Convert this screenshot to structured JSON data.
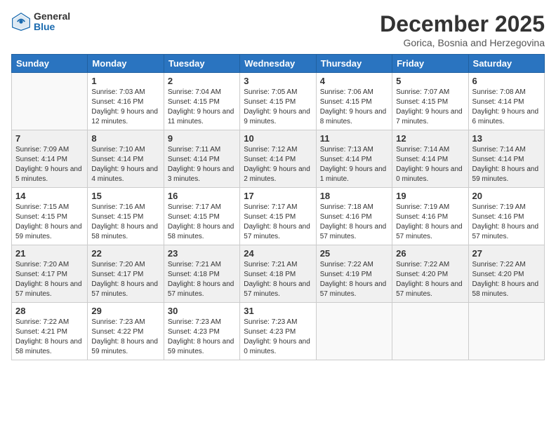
{
  "logo": {
    "general": "General",
    "blue": "Blue"
  },
  "title": "December 2025",
  "subtitle": "Gorica, Bosnia and Herzegovina",
  "days_header": [
    "Sunday",
    "Monday",
    "Tuesday",
    "Wednesday",
    "Thursday",
    "Friday",
    "Saturday"
  ],
  "weeks": [
    [
      {
        "day": "",
        "sunrise": "",
        "sunset": "",
        "daylight": ""
      },
      {
        "day": "1",
        "sunrise": "Sunrise: 7:03 AM",
        "sunset": "Sunset: 4:16 PM",
        "daylight": "Daylight: 9 hours and 12 minutes."
      },
      {
        "day": "2",
        "sunrise": "Sunrise: 7:04 AM",
        "sunset": "Sunset: 4:15 PM",
        "daylight": "Daylight: 9 hours and 11 minutes."
      },
      {
        "day": "3",
        "sunrise": "Sunrise: 7:05 AM",
        "sunset": "Sunset: 4:15 PM",
        "daylight": "Daylight: 9 hours and 9 minutes."
      },
      {
        "day": "4",
        "sunrise": "Sunrise: 7:06 AM",
        "sunset": "Sunset: 4:15 PM",
        "daylight": "Daylight: 9 hours and 8 minutes."
      },
      {
        "day": "5",
        "sunrise": "Sunrise: 7:07 AM",
        "sunset": "Sunset: 4:15 PM",
        "daylight": "Daylight: 9 hours and 7 minutes."
      },
      {
        "day": "6",
        "sunrise": "Sunrise: 7:08 AM",
        "sunset": "Sunset: 4:14 PM",
        "daylight": "Daylight: 9 hours and 6 minutes."
      }
    ],
    [
      {
        "day": "7",
        "sunrise": "Sunrise: 7:09 AM",
        "sunset": "Sunset: 4:14 PM",
        "daylight": "Daylight: 9 hours and 5 minutes."
      },
      {
        "day": "8",
        "sunrise": "Sunrise: 7:10 AM",
        "sunset": "Sunset: 4:14 PM",
        "daylight": "Daylight: 9 hours and 4 minutes."
      },
      {
        "day": "9",
        "sunrise": "Sunrise: 7:11 AM",
        "sunset": "Sunset: 4:14 PM",
        "daylight": "Daylight: 9 hours and 3 minutes."
      },
      {
        "day": "10",
        "sunrise": "Sunrise: 7:12 AM",
        "sunset": "Sunset: 4:14 PM",
        "daylight": "Daylight: 9 hours and 2 minutes."
      },
      {
        "day": "11",
        "sunrise": "Sunrise: 7:13 AM",
        "sunset": "Sunset: 4:14 PM",
        "daylight": "Daylight: 9 hours and 1 minute."
      },
      {
        "day": "12",
        "sunrise": "Sunrise: 7:14 AM",
        "sunset": "Sunset: 4:14 PM",
        "daylight": "Daylight: 9 hours and 0 minutes."
      },
      {
        "day": "13",
        "sunrise": "Sunrise: 7:14 AM",
        "sunset": "Sunset: 4:14 PM",
        "daylight": "Daylight: 8 hours and 59 minutes."
      }
    ],
    [
      {
        "day": "14",
        "sunrise": "Sunrise: 7:15 AM",
        "sunset": "Sunset: 4:15 PM",
        "daylight": "Daylight: 8 hours and 59 minutes."
      },
      {
        "day": "15",
        "sunrise": "Sunrise: 7:16 AM",
        "sunset": "Sunset: 4:15 PM",
        "daylight": "Daylight: 8 hours and 58 minutes."
      },
      {
        "day": "16",
        "sunrise": "Sunrise: 7:17 AM",
        "sunset": "Sunset: 4:15 PM",
        "daylight": "Daylight: 8 hours and 58 minutes."
      },
      {
        "day": "17",
        "sunrise": "Sunrise: 7:17 AM",
        "sunset": "Sunset: 4:15 PM",
        "daylight": "Daylight: 8 hours and 57 minutes."
      },
      {
        "day": "18",
        "sunrise": "Sunrise: 7:18 AM",
        "sunset": "Sunset: 4:16 PM",
        "daylight": "Daylight: 8 hours and 57 minutes."
      },
      {
        "day": "19",
        "sunrise": "Sunrise: 7:19 AM",
        "sunset": "Sunset: 4:16 PM",
        "daylight": "Daylight: 8 hours and 57 minutes."
      },
      {
        "day": "20",
        "sunrise": "Sunrise: 7:19 AM",
        "sunset": "Sunset: 4:16 PM",
        "daylight": "Daylight: 8 hours and 57 minutes."
      }
    ],
    [
      {
        "day": "21",
        "sunrise": "Sunrise: 7:20 AM",
        "sunset": "Sunset: 4:17 PM",
        "daylight": "Daylight: 8 hours and 57 minutes."
      },
      {
        "day": "22",
        "sunrise": "Sunrise: 7:20 AM",
        "sunset": "Sunset: 4:17 PM",
        "daylight": "Daylight: 8 hours and 57 minutes."
      },
      {
        "day": "23",
        "sunrise": "Sunrise: 7:21 AM",
        "sunset": "Sunset: 4:18 PM",
        "daylight": "Daylight: 8 hours and 57 minutes."
      },
      {
        "day": "24",
        "sunrise": "Sunrise: 7:21 AM",
        "sunset": "Sunset: 4:18 PM",
        "daylight": "Daylight: 8 hours and 57 minutes."
      },
      {
        "day": "25",
        "sunrise": "Sunrise: 7:22 AM",
        "sunset": "Sunset: 4:19 PM",
        "daylight": "Daylight: 8 hours and 57 minutes."
      },
      {
        "day": "26",
        "sunrise": "Sunrise: 7:22 AM",
        "sunset": "Sunset: 4:20 PM",
        "daylight": "Daylight: 8 hours and 57 minutes."
      },
      {
        "day": "27",
        "sunrise": "Sunrise: 7:22 AM",
        "sunset": "Sunset: 4:20 PM",
        "daylight": "Daylight: 8 hours and 58 minutes."
      }
    ],
    [
      {
        "day": "28",
        "sunrise": "Sunrise: 7:22 AM",
        "sunset": "Sunset: 4:21 PM",
        "daylight": "Daylight: 8 hours and 58 minutes."
      },
      {
        "day": "29",
        "sunrise": "Sunrise: 7:23 AM",
        "sunset": "Sunset: 4:22 PM",
        "daylight": "Daylight: 8 hours and 59 minutes."
      },
      {
        "day": "30",
        "sunrise": "Sunrise: 7:23 AM",
        "sunset": "Sunset: 4:23 PM",
        "daylight": "Daylight: 8 hours and 59 minutes."
      },
      {
        "day": "31",
        "sunrise": "Sunrise: 7:23 AM",
        "sunset": "Sunset: 4:23 PM",
        "daylight": "Daylight: 9 hours and 0 minutes."
      },
      {
        "day": "",
        "sunrise": "",
        "sunset": "",
        "daylight": ""
      },
      {
        "day": "",
        "sunrise": "",
        "sunset": "",
        "daylight": ""
      },
      {
        "day": "",
        "sunrise": "",
        "sunset": "",
        "daylight": ""
      }
    ]
  ]
}
